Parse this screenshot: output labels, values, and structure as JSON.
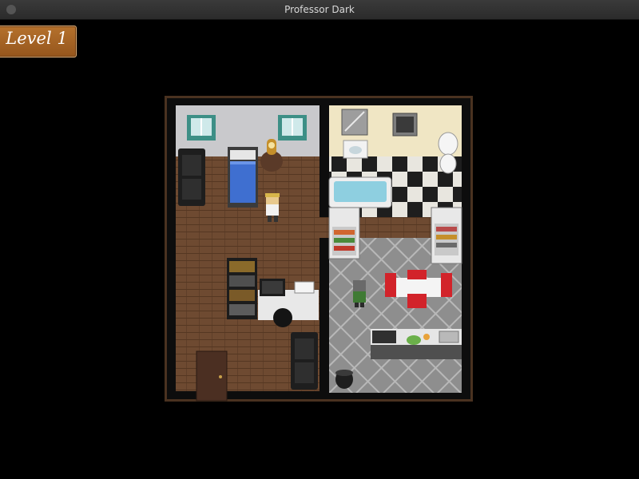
{
  "window": {
    "title": "Professor Dark"
  },
  "hud": {
    "level_label": "Level 1"
  },
  "icons": {
    "window_control": "window-close-dot",
    "player": "scientist-sprite",
    "npc": "zombie-sprite"
  },
  "colors": {
    "background": "#000000",
    "titlebar": "#2f2f2f",
    "level_badge": "#a8652a",
    "floor_wood": "#6d4a32",
    "kitchen_tile": "#8f8f8f",
    "bathroom_wall": "#f0e6c4",
    "bedroom_wall": "#c9c9cc"
  }
}
